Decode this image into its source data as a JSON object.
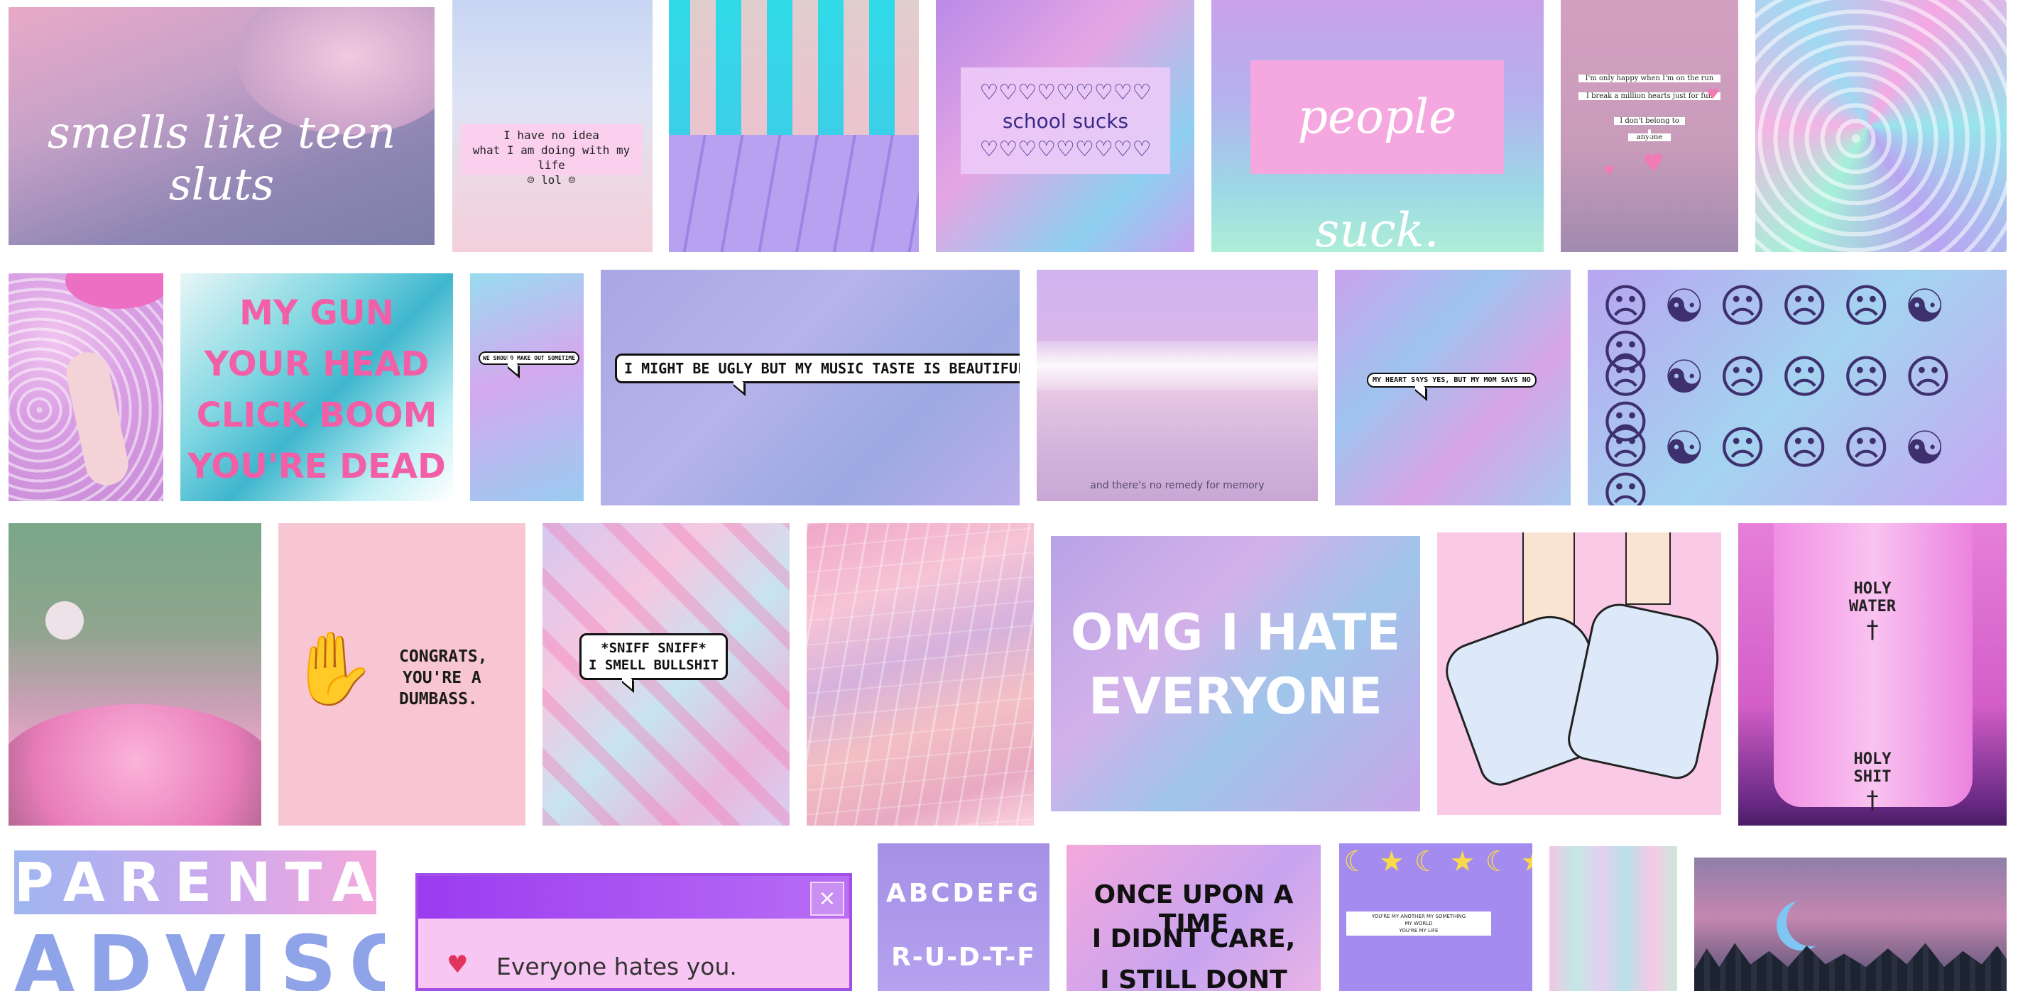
{
  "collage": {
    "t1": "smells like teen sluts",
    "t2_l1": "I have no idea",
    "t2_l2": "what I am doing with my life",
    "t2_l3": "☺ lol ☺",
    "t4_hearts1": "♡♡♡♡♡♡♡♡♡",
    "t4_text": "school sucks",
    "t4_hearts2": "♡♡♡♡♡♡♡♡♡",
    "t5": "people suck.",
    "t6_l1": "I'm only happy when I'm on the run",
    "t6_l2": "I break a million hearts just for fun",
    "t6_l3": "I don't belong to",
    "t6_l4": "anyone",
    "t6_l5": "!",
    "t9_l1": "MY GUN",
    "t9_l2": "YOUR HEAD",
    "t9_l3": "CLICK BOOM",
    "t9_l4": "YOU'RE DEAD",
    "t10": "WE SHOULD MAKE OUT SOMETIME",
    "t11": "I MIGHT BE UGLY BUT MY MUSIC TASTE IS BEAUTIFUL",
    "t12": "and there's no remedy for memory",
    "t13": "MY HEART SAYS YES, BUT MY MOM SAYS NO",
    "t16_l1": "CONGRATS,",
    "t16_l2": "YOU'RE A",
    "t16_l3": "DUMBASS.",
    "t17_l1": "*SNIFF SNIFF*",
    "t17_l2": "I SMELL BULLSHIT",
    "t19_l1": "OMG I HATE",
    "t19_l2": "EVERYONE",
    "t21_l1": "HOLY",
    "t21_l2": "WATER",
    "t21_l3": "HOLY",
    "t21_l4": "SHIT",
    "cross": "†",
    "t22_l1": "PARENTAL",
    "t22_l2": "ADVISORY",
    "t23_close": "×",
    "t23_msg": "Everyone hates you.",
    "t24_l1": "ABCDEFG",
    "t24_l2": "R-U-D-T-F",
    "t25_l1": "ONCE UPON A TIME",
    "t25_l2": "I DIDNT CARE,",
    "t25_l3": "I STILL DONT",
    "t26_l1": "YOU'RE MY ANOTHER MY SOMETHING",
    "t26_l2": "MY WORLD",
    "t26_l3": "YOU'RE MY LIFE"
  },
  "colors": {
    "pastel_pink": "#f4b8dc",
    "pastel_purple": "#b9a6ec",
    "pastel_blue": "#a9c8f0",
    "hot_pink": "#e84fb0",
    "violet": "#8a2be2"
  },
  "icons": [
    "heart-icon",
    "moon-icon",
    "hand-icon",
    "close-icon",
    "cross-icon",
    "sad-face-icon",
    "yin-yang-icon"
  ]
}
